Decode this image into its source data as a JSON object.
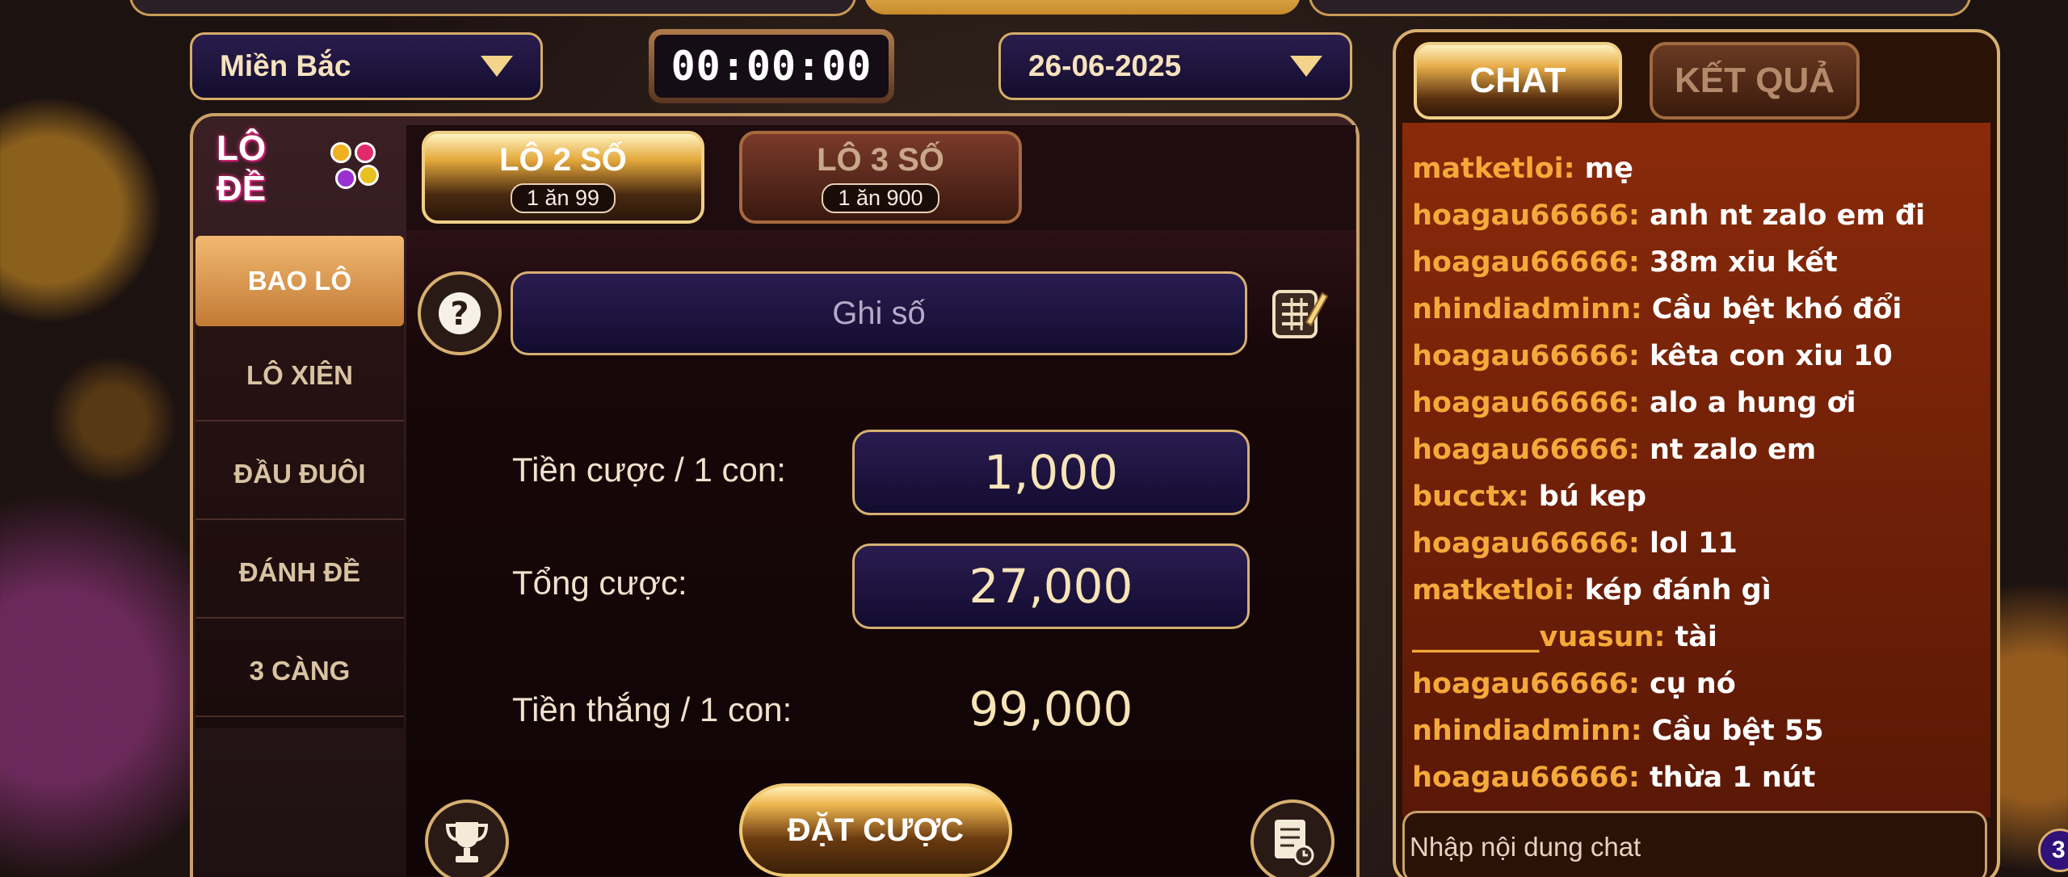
{
  "header": {
    "region_select": "Miền Bắc",
    "timer": "00:00:00",
    "date_select": "26-06-2025"
  },
  "logo": {
    "text": "LÔ ĐỀ"
  },
  "sidebar": {
    "items": [
      "BAO LÔ",
      "LÔ XIÊN",
      "ĐẦU ĐUÔI",
      "ĐÁNH ĐỀ",
      "3 CÀNG"
    ],
    "active_index": 0
  },
  "tabs": [
    {
      "label": "LÔ 2 SỐ",
      "odds": "1 ăn 99",
      "active": true
    },
    {
      "label": "LÔ 3 SỐ",
      "odds": "1 ăn 900",
      "active": false
    }
  ],
  "form": {
    "number_placeholder": "Ghi số",
    "bet_per_label": "Tiền cược / 1 con:",
    "bet_per_value": "1,000",
    "total_label": "Tổng cược:",
    "total_value": "27,000",
    "win_label": "Tiền thắng / 1 con:",
    "win_value": "99,000",
    "submit_label": "ĐẶT CƯỢC"
  },
  "chat": {
    "tabs": [
      "CHAT",
      "KẾT QUẢ"
    ],
    "active_tab": 0,
    "messages": [
      {
        "user": "matketloi:",
        "text": "mẹ"
      },
      {
        "user": "hoagau66666:",
        "text": "anh nt zalo em đi"
      },
      {
        "user": "hoagau66666:",
        "text": "38m xiu kết"
      },
      {
        "user": "nhindiadminn:",
        "text": "Cầu bệt khó đổi"
      },
      {
        "user": "hoagau66666:",
        "text": "kêta con xiu 10"
      },
      {
        "user": "hoagau66666:",
        "text": "alo a hung ơi"
      },
      {
        "user": "hoagau66666:",
        "text": "nt zalo em"
      },
      {
        "user": "bucctx:",
        "text": "bú kep"
      },
      {
        "user": "hoagau66666:",
        "text": "lol 11"
      },
      {
        "user": "matketloi:",
        "text": "kép đánh gì"
      },
      {
        "user": "_________vuasun:",
        "text": "tài"
      },
      {
        "user": "hoagau66666:",
        "text": "cụ nó"
      },
      {
        "user": "nhindiadminn:",
        "text": "Cầu bệt 55"
      },
      {
        "user": "hoagau66666:",
        "text": "thừa 1 nút"
      }
    ],
    "input_placeholder": "Nhập nội dung chat",
    "badge": "3"
  },
  "colors": {
    "accent_gold": "#d7b070",
    "chat_username": "#f5a93a",
    "field_bg": "#1e1440",
    "chat_bg": "#7a2408"
  }
}
